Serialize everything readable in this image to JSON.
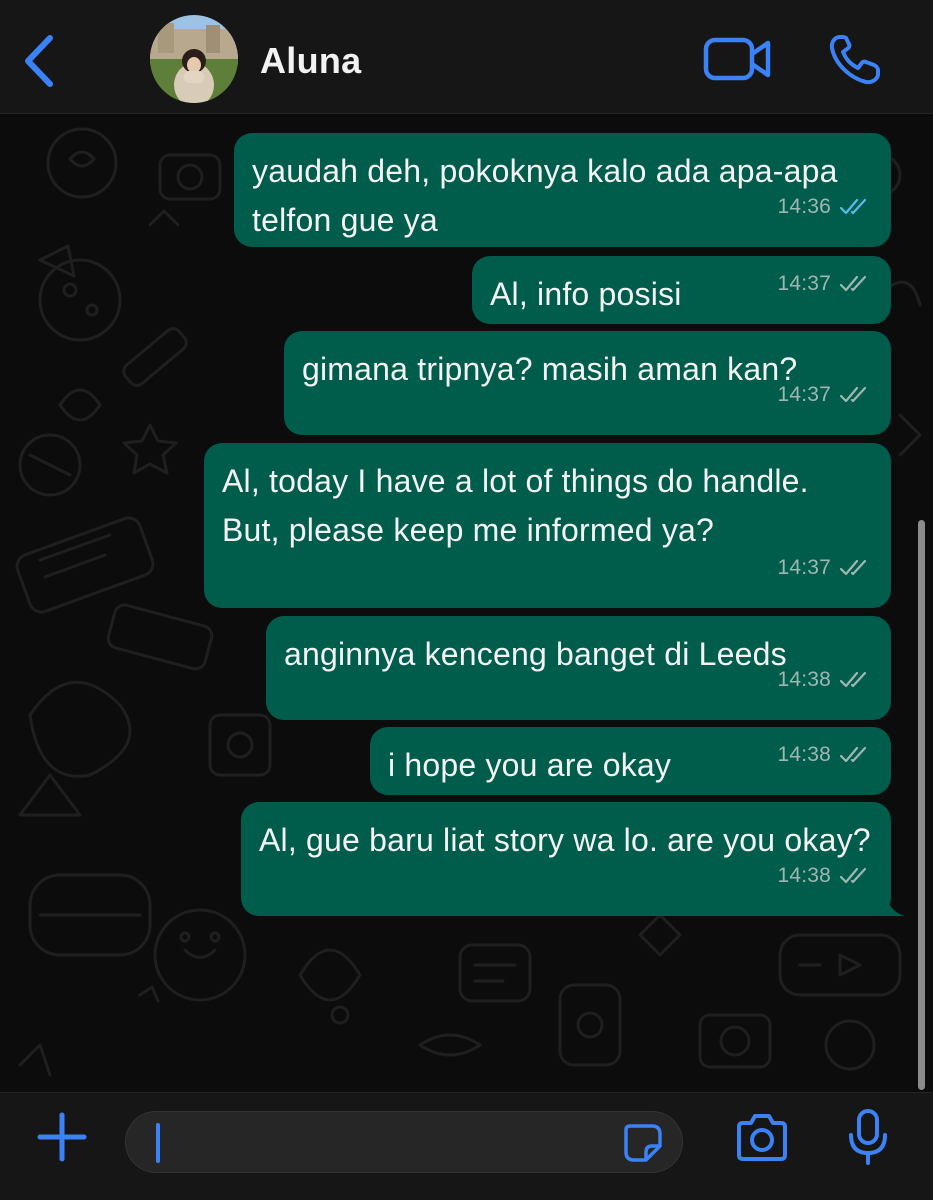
{
  "header": {
    "contact_name": "Aluna",
    "icons": [
      "chevron-left-icon",
      "video-camera-icon",
      "phone-icon"
    ]
  },
  "messages": [
    {
      "text": "yaudah deh, pokoknya kalo ada apa-apa telfon gue ya",
      "time": "14:36",
      "status": "read"
    },
    {
      "text": "Al, info posisi",
      "time": "14:37",
      "status": "delivered"
    },
    {
      "text": "gimana tripnya? masih aman kan?",
      "time": "14:37",
      "status": "delivered"
    },
    {
      "text": "Al, today I have a lot of things do handle. But, please keep me informed ya?",
      "time": "14:37",
      "status": "delivered"
    },
    {
      "text": "anginnya kenceng banget di Leeds",
      "time": "14:38",
      "status": "delivered"
    },
    {
      "text": "i hope you are okay",
      "time": "14:38",
      "status": "delivered"
    },
    {
      "text": "Al, gue baru liat story wa lo. are you okay?",
      "time": "14:38",
      "status": "delivered"
    }
  ],
  "composer": {
    "value": "",
    "icons": [
      "plus-icon",
      "sticker-icon",
      "camera-icon",
      "microphone-icon"
    ]
  },
  "colors": {
    "accent": "#3b82f6",
    "bubble_outgoing": "#005c4b",
    "read_tick": "#53bdeb",
    "delivered_tick": "#9fb7b0",
    "background": "#0c0c0c"
  }
}
